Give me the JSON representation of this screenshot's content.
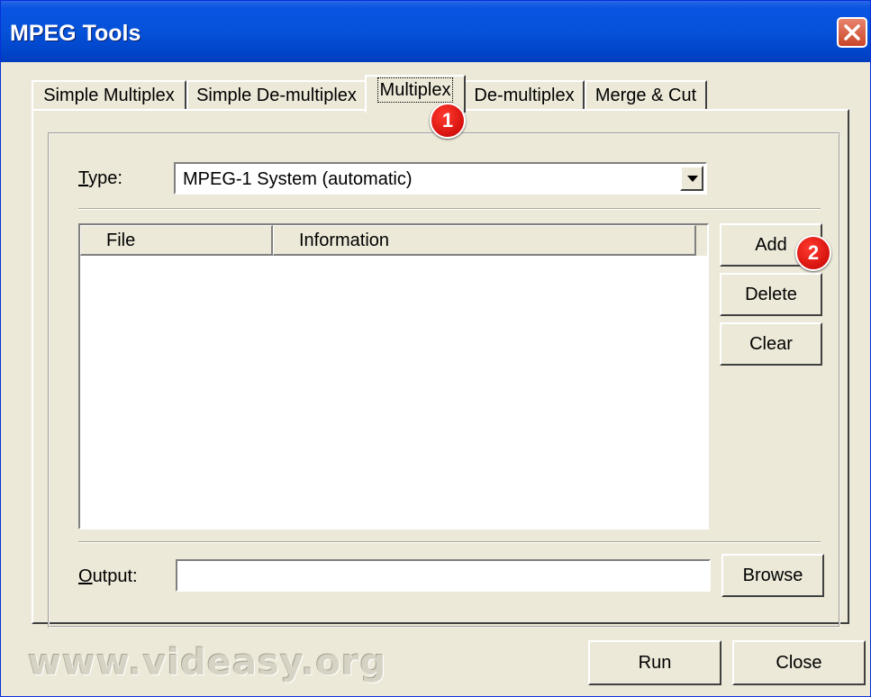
{
  "window": {
    "title": "MPEG Tools"
  },
  "tabs": [
    {
      "label": "Simple Multiplex",
      "active": false
    },
    {
      "label": "Simple De-multiplex",
      "active": false
    },
    {
      "label": "Multiplex",
      "active": true
    },
    {
      "label": "De-multiplex",
      "active": false
    },
    {
      "label": "Merge & Cut",
      "active": false
    }
  ],
  "type": {
    "label_u": "T",
    "label_rest": "ype:",
    "value": "MPEG-1 System (automatic)"
  },
  "file_list": {
    "columns": [
      "File",
      "Information"
    ],
    "rows": []
  },
  "buttons": {
    "add": "Add",
    "delete": "Delete",
    "clear": "Clear",
    "browse": "Browse",
    "run": "Run",
    "close": "Close"
  },
  "output": {
    "label_u": "O",
    "label_rest": "utput:",
    "value": ""
  },
  "annotations": {
    "marker1": "1",
    "marker2": "2"
  },
  "watermark": "www.videasy.org",
  "icons": {
    "close": "close-x-icon",
    "dropdown": "dropdown-arrow-icon"
  },
  "colors": {
    "titlebar": "#0552d8",
    "marker": "#d40000",
    "face": "#ece9d8"
  }
}
